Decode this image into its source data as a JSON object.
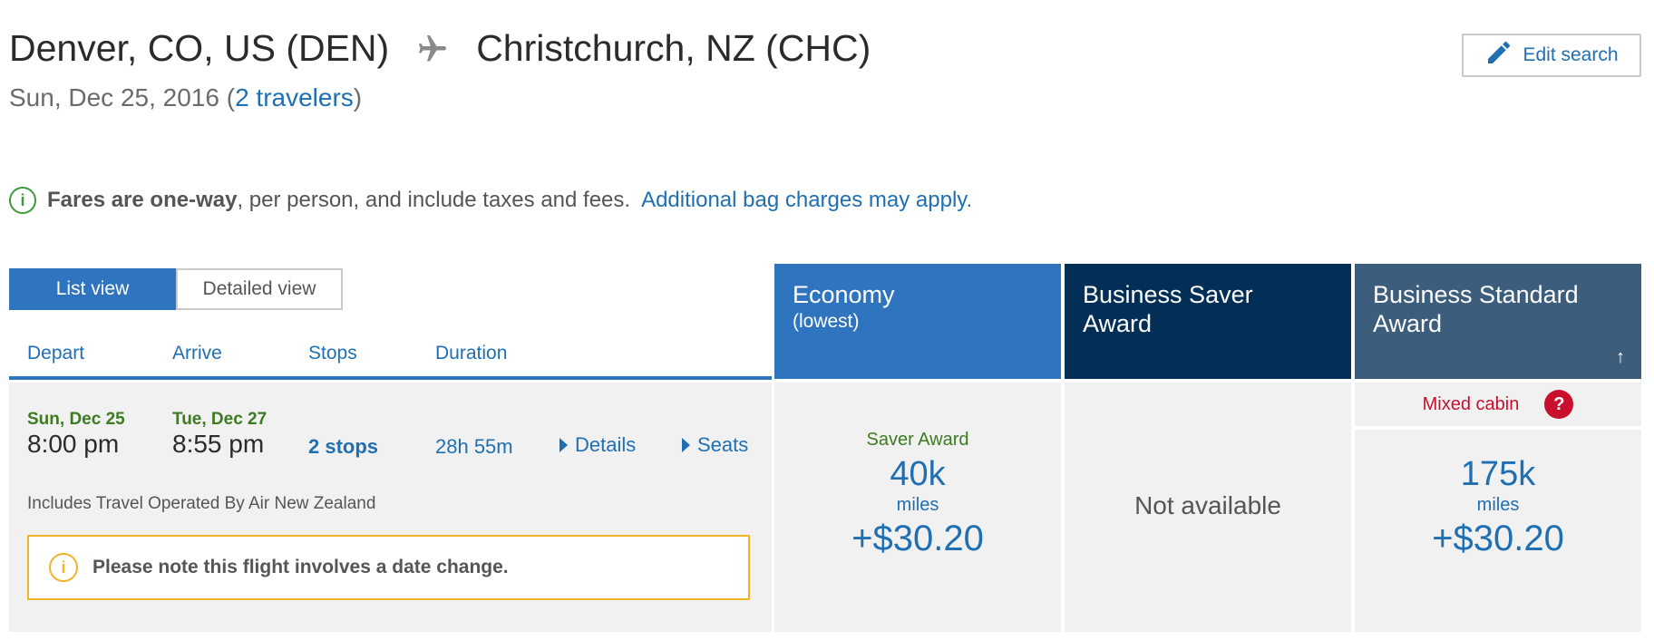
{
  "header": {
    "origin": "Denver, CO, US (DEN)",
    "destination": "Christchurch, NZ (CHC)",
    "plane_icon": "airplane-icon",
    "date": "Sun, Dec 25, 2016",
    "paren_open": "(",
    "travelers_link": "2 travelers",
    "paren_close": ")",
    "edit_search": "Edit search",
    "edit_icon": "pencil-icon"
  },
  "notice": {
    "bold": "Fares are one-way",
    "rest": ", per person, and include taxes and fees.",
    "link": "Additional bag charges may apply."
  },
  "view_toggle": {
    "list": "List view",
    "detailed": "Detailed view",
    "selected": "List view"
  },
  "columns": {
    "depart": "Depart",
    "arrive": "Arrive",
    "stops": "Stops",
    "duration": "Duration"
  },
  "fare_columns": [
    {
      "title": "Economy",
      "subtitle": "(lowest)",
      "color": "#2f74be"
    },
    {
      "title": "Business Saver",
      "title2": "Award",
      "color": "#032f56"
    },
    {
      "title": "Business Standard",
      "title2": "Award",
      "color": "#3d5d7d",
      "sort_icon": "↑"
    }
  ],
  "flight": {
    "depart_date": "Sun, Dec 25",
    "depart_time": "8:00 pm",
    "arrive_date": "Tue, Dec 27",
    "arrive_time": "8:55 pm",
    "stops": "2 stops",
    "duration": "28h 55m",
    "details_link": "Details",
    "seats_link": "Seats",
    "operated_by": "Includes Travel Operated By Air New Zealand",
    "date_change_warning": "Please note this flight involves a date change.",
    "fares": {
      "economy": {
        "label": "Saver Award",
        "miles": "40k",
        "miles_unit": "miles",
        "price": "+$30.20"
      },
      "business_saver": {
        "status": "Not available"
      },
      "business_standard": {
        "mixed": "Mixed cabin",
        "help": "?",
        "miles": "175k",
        "miles_unit": "miles",
        "price": "+$30.20"
      }
    }
  },
  "colors": {
    "link": "#1f6fb2",
    "date_green": "#3d7a22",
    "warning": "#f0b429",
    "mixed_red": "#c8102e"
  }
}
